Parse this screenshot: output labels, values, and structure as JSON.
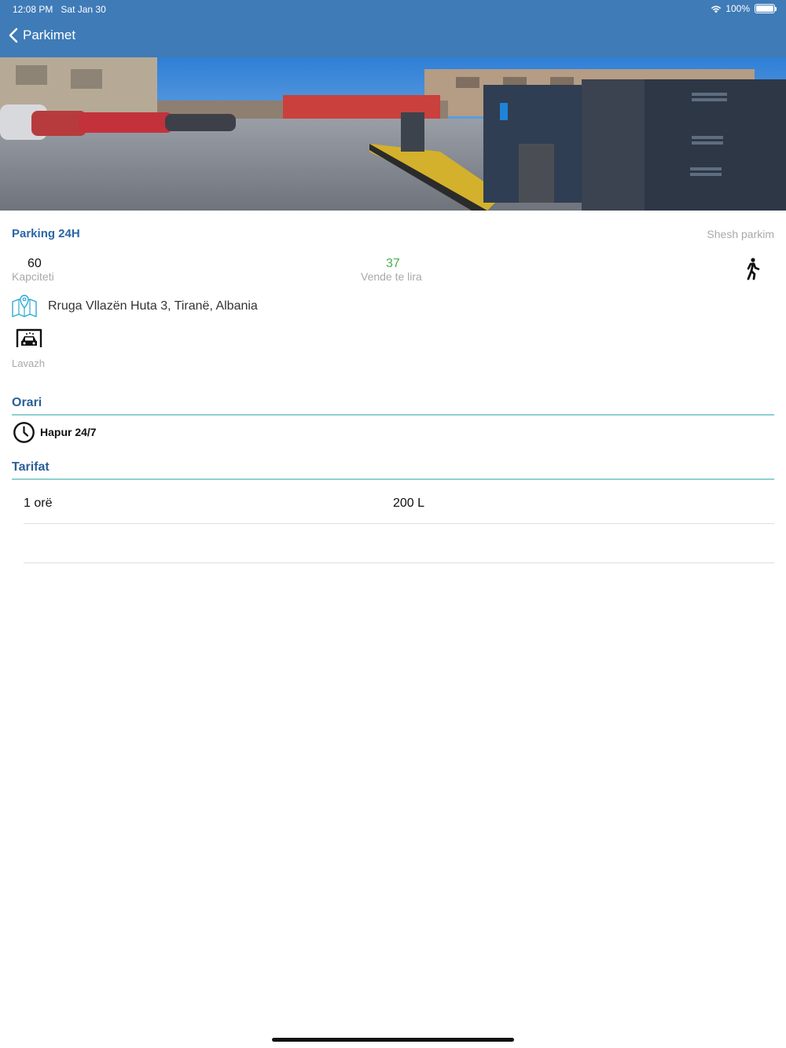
{
  "status_bar": {
    "time": "12:08 PM",
    "date": "Sat Jan 30",
    "battery": "100%"
  },
  "nav": {
    "back_label": "Parkimet",
    "bar_color": "#3f7bb7"
  },
  "parking": {
    "name": "Parking 24H",
    "type": "Shesh parkim",
    "capacity": {
      "value": "60",
      "label": "Kapciteti"
    },
    "free_spots": {
      "value": "37",
      "label": "Vende te lira"
    },
    "access_icon": "walking-person-icon",
    "address": "Rruga Vllazën Huta 3, Tiranë, Albania",
    "services": [
      {
        "label": "Lavazh",
        "icon": "car-wash-icon"
      }
    ]
  },
  "schedule": {
    "title": "Orari",
    "hours": "Hapur 24/7"
  },
  "tariffs": {
    "title": "Tarifat",
    "rows": [
      {
        "duration": "1 orë",
        "price": "200 L"
      },
      {
        "duration": "",
        "price": ""
      }
    ]
  },
  "colors": {
    "accent": "#2a66a6",
    "free": "#4caf50",
    "divider": "#8fd0cf",
    "muted": "#a9a9a9"
  }
}
